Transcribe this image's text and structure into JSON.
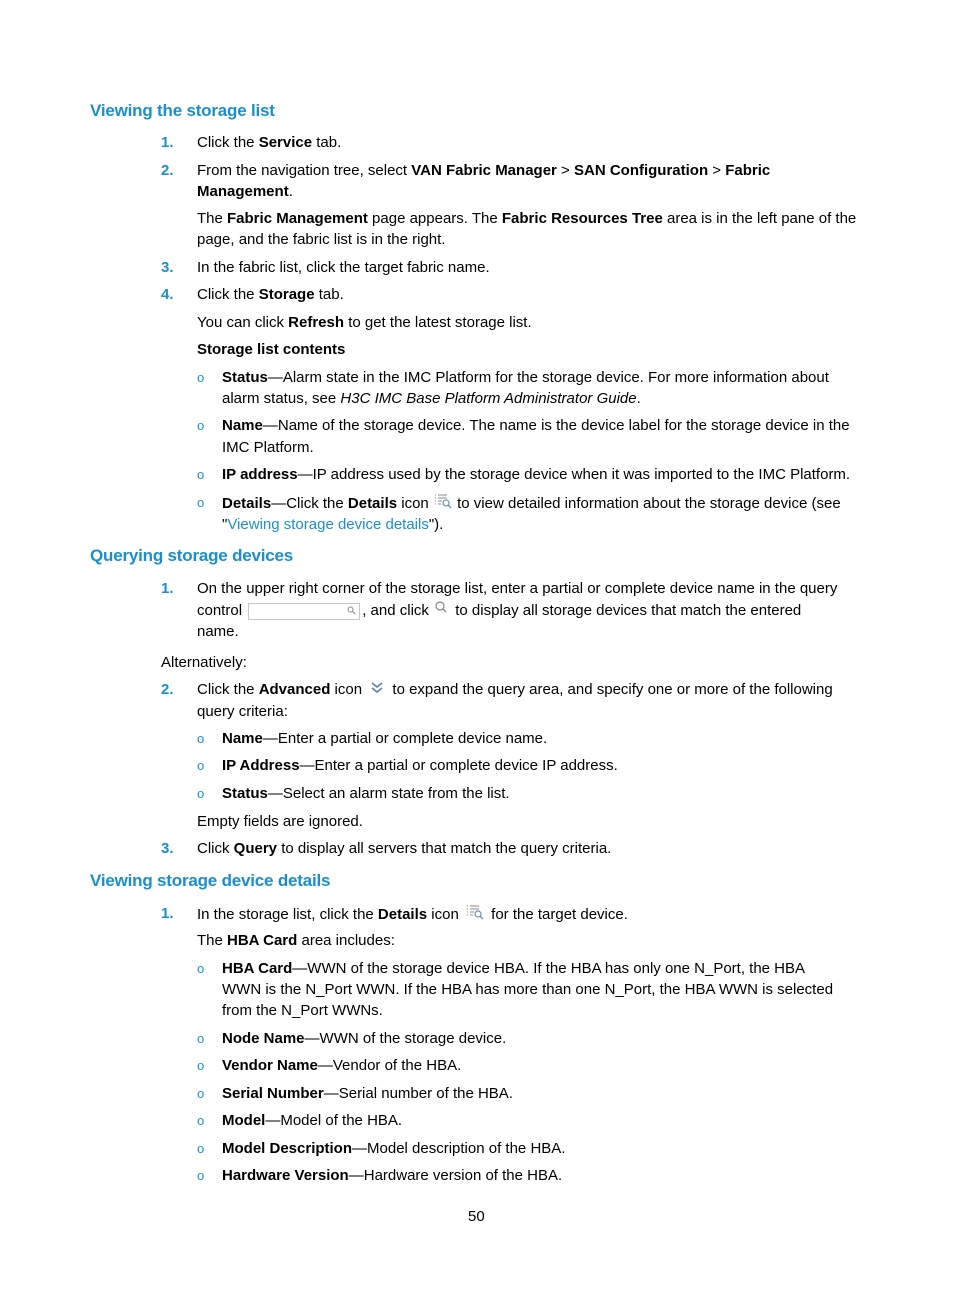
{
  "sections": {
    "viewing_list": {
      "heading": "Viewing the storage list",
      "step1": {
        "num": "1.",
        "a": "Click the ",
        "b": "Service",
        "c": " tab."
      },
      "step2": {
        "num": "2.",
        "a": "From the navigation tree, select ",
        "b1": "VAN Fabric Manager",
        "s1": " > ",
        "b2": "SAN Configuration",
        "s2": " > ",
        "b3": "Fabric",
        "b4": "Management",
        "end": "."
      },
      "step2_note": {
        "a": "The ",
        "b1": "Fabric Management",
        "m": " page appears. The ",
        "b2": "Fabric Resources Tree",
        "c": " area is in the left pane of the",
        "line2": "page, and the fabric list is in the right."
      },
      "step3": {
        "num": "3.",
        "text": "In the fabric list, click the target fabric name."
      },
      "step4": {
        "num": "4.",
        "a": "Click the ",
        "b": "Storage",
        "c": " tab."
      },
      "step4_note": {
        "a": "You can click ",
        "b": "Refresh",
        "c": " to get the latest storage list."
      },
      "contents_title": "Storage list contents",
      "bullets": [
        {
          "term": "Status",
          "desc": "—Alarm state in the IMC Platform for the storage device. For more information about",
          "line2a": "alarm status, see ",
          "line2i": "H3C IMC Base Platform Administrator Guide",
          "line2b": "."
        },
        {
          "term": "Name",
          "desc": "—Name of the storage device. The name is the device label for the storage device in the",
          "line2": "IMC Platform."
        },
        {
          "term": "IP address",
          "desc": "—IP address used by the storage device when it was imported to the IMC Platform."
        },
        {
          "term": "Details",
          "desc_a": "—Click the ",
          "desc_b": "Details",
          "desc_c": " icon ",
          "desc_d": " to view detailed information about the storage device (see",
          "line2a": "\"",
          "line2link": "Viewing storage device details",
          "line2b": "\")."
        }
      ]
    },
    "querying": {
      "heading": "Querying storage devices",
      "step1": {
        "num": "1.",
        "line1": "On the upper right corner of the storage list, enter a partial or complete device name in the query",
        "a": "control ",
        "b": ", and click ",
        "c": " to display all storage devices that match the entered",
        "line3": "name."
      },
      "alt": "Alternatively:",
      "step2": {
        "num": "2.",
        "a": "Click the ",
        "b": "Advanced",
        "c": " icon ",
        "d": " to expand the query area, and specify one or more of the following",
        "line2": "query criteria:"
      },
      "bullets": [
        {
          "term": "Name",
          "desc": "—Enter a partial or complete device name."
        },
        {
          "term": "IP Address",
          "desc": "—Enter a partial or complete device IP address."
        },
        {
          "term": "Status",
          "desc": "—Select an alarm state from the list."
        }
      ],
      "note": "Empty fields are ignored.",
      "step3": {
        "num": "3.",
        "a": "Click ",
        "b": "Query",
        "c": " to display all servers that match the query criteria."
      }
    },
    "details": {
      "heading": "Viewing storage device details",
      "step1": {
        "num": "1.",
        "a": "In the storage list, click the ",
        "b": "Details",
        "c": " icon ",
        "d": " for the target device."
      },
      "note": {
        "a": "The ",
        "b": "HBA Card",
        "c": " area includes:"
      },
      "bullets": [
        {
          "term": "HBA Card",
          "desc": "—WWN of the storage device HBA. If the HBA has only one N_Port, the HBA",
          "line2": "WWN is the N_Port WWN. If the HBA has more than one N_Port, the HBA WWN is selected",
          "line3": "from the N_Port WWNs."
        },
        {
          "term": "Node Name",
          "desc": "—WWN of the storage device."
        },
        {
          "term": "Vendor Name",
          "desc": "—Vendor of the HBA."
        },
        {
          "term": "Serial Number",
          "desc": "—Serial number of the HBA."
        },
        {
          "term": "Model",
          "desc": "—Model of the HBA."
        },
        {
          "term": "Model Description",
          "desc": "—Model description of the HBA."
        },
        {
          "term": "Hardware Version",
          "desc": "—Hardware version of the HBA."
        }
      ]
    }
  },
  "bullet_glyph": "o",
  "page_number": "50",
  "colors": {
    "accent": "#1a8fcf",
    "text": "#000000"
  }
}
